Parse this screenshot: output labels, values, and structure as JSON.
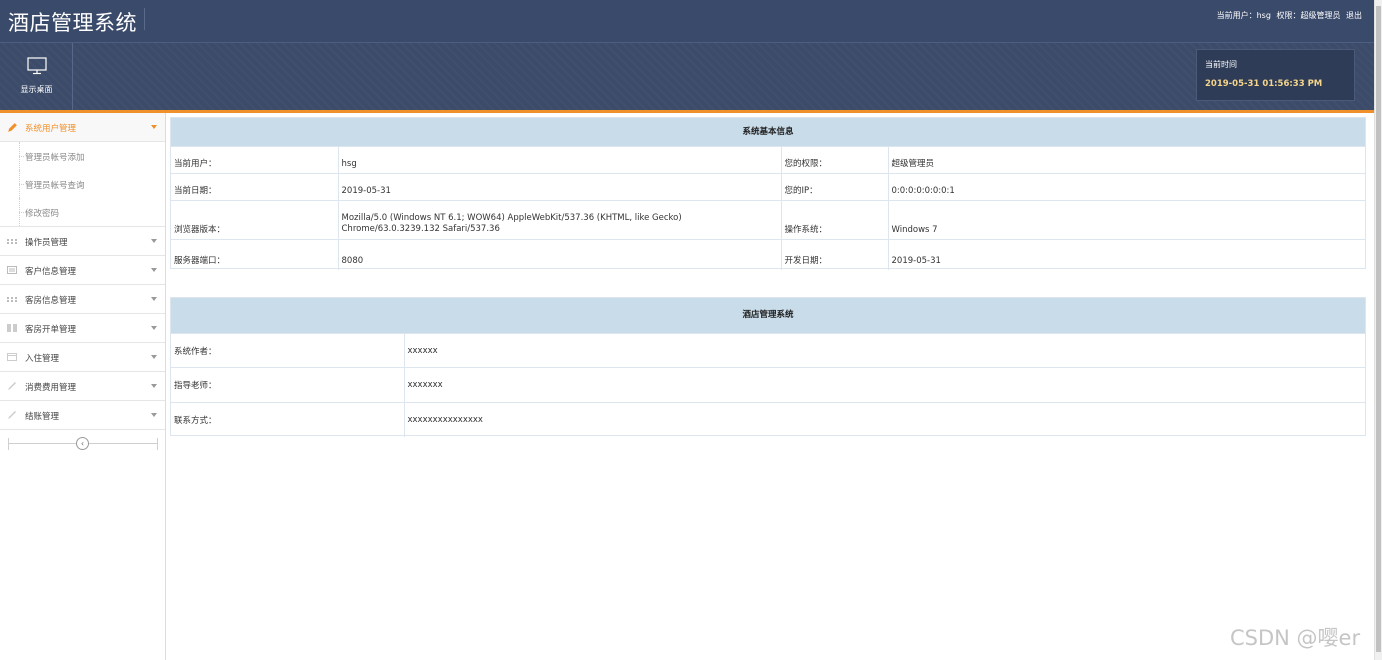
{
  "header": {
    "app_title": "酒店管理系统",
    "current_user_label": "当前用户：",
    "current_user": "hsg",
    "permission_label": "权限：",
    "permission": "超级管理员",
    "logout": "退出"
  },
  "toolbar": {
    "show_desktop_label": "显示桌面",
    "time_label": "当前时间",
    "time_value": "2019-05-31 01:56:33 PM"
  },
  "sidebar": {
    "items": [
      {
        "label": "系统用户管理",
        "icon": "pencil-icon",
        "active": true,
        "children": [
          "管理员帐号添加",
          "管理员帐号查询",
          "修改密码"
        ]
      },
      {
        "label": "操作员管理",
        "icon": "grid-icon"
      },
      {
        "label": "客户信息管理",
        "icon": "card-icon"
      },
      {
        "label": "客房信息管理",
        "icon": "grid-icon"
      },
      {
        "label": "客房开单管理",
        "icon": "columns-icon"
      },
      {
        "label": "入住管理",
        "icon": "calendar-icon"
      },
      {
        "label": "消费费用管理",
        "icon": "pen-icon"
      },
      {
        "label": "结账管理",
        "icon": "pen-icon"
      }
    ],
    "collapse_glyph": "‹"
  },
  "system_info": {
    "title": "系统基本信息",
    "rows": [
      [
        "当前用户：",
        "hsg",
        "您的权限：",
        "超级管理员"
      ],
      [
        "当前日期：",
        "2019-05-31",
        "您的IP：",
        "0:0:0:0:0:0:0:1"
      ],
      [
        "浏览器版本：",
        "Mozilla/5.0 (Windows NT 6.1; WOW64) AppleWebKit/537.36 (KHTML, like Gecko) Chrome/63.0.3239.132 Safari/537.36",
        "操作系统：",
        "Windows 7"
      ],
      [
        "服务器端口：",
        "8080",
        "开发日期：",
        "2019-05-31"
      ]
    ]
  },
  "hotel_info": {
    "title": "酒店管理系统",
    "rows": [
      [
        "系统作者：",
        "xxxxxx"
      ],
      [
        "指导老师：",
        "xxxxxxx"
      ],
      [
        "联系方式：",
        "xxxxxxxxxxxxxxx"
      ]
    ]
  },
  "watermark": "CSDN @嘤er"
}
